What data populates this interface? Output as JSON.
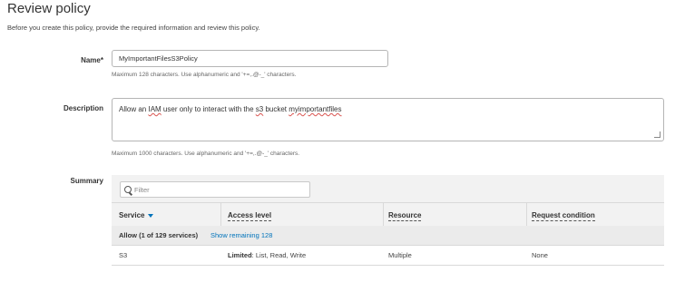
{
  "page": {
    "title": "Review policy",
    "intro": "Before you create this policy, provide the required information and review this policy."
  },
  "name_field": {
    "label": "Name",
    "required_mark": "*",
    "value": "MyImportantFilesS3Policy",
    "hint": "Maximum 128 characters. Use alphanumeric and '+=,.@-_' characters."
  },
  "description_field": {
    "label": "Description",
    "value_parts": [
      "Allow an ",
      "IAM",
      " user only to interact with the ",
      "s3",
      " bucket ",
      "myimportantfiles"
    ],
    "hint": "Maximum 1000 characters. Use alphanumeric and '+=,.@-_' characters."
  },
  "summary": {
    "label": "Summary",
    "filter_placeholder": "Filter",
    "columns": [
      "Service",
      "Access level",
      "Resource",
      "Request condition"
    ],
    "group_row": {
      "text": "Allow (1 of 129 services)",
      "link": "Show remaining 128"
    },
    "rows": [
      {
        "service": "S3",
        "access_bold": "Limited",
        "access_rest": ": List, Read, Write",
        "resource": "Multiple",
        "condition": "None"
      }
    ]
  },
  "colors": {
    "link": "#0073bb",
    "panel": "#f2f2f2",
    "group_row": "#ebebeb"
  }
}
